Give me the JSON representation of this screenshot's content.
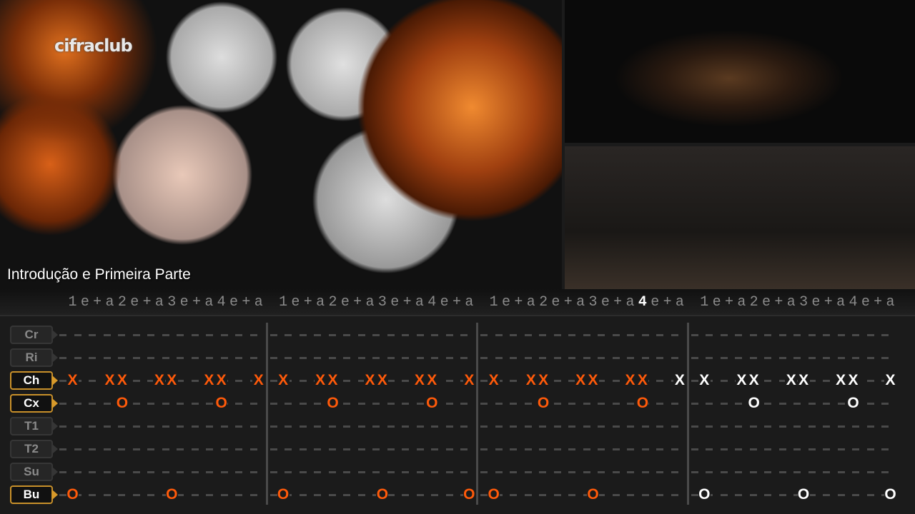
{
  "video": {
    "caption": "Introdução e Primeira Parte",
    "logo": "cifraclub"
  },
  "count": [
    "1",
    "e",
    "+",
    "a",
    "2",
    "e",
    "+",
    "a",
    "3",
    "e",
    "+",
    "a",
    "4",
    "e",
    "+",
    "a"
  ],
  "playhead": {
    "measure": 3,
    "position": 13
  },
  "colors": {
    "played": "#ff5a0a",
    "upcoming": "#ffffff",
    "accent": "#c8902a"
  },
  "rows": [
    {
      "label": "Cr",
      "active": false,
      "measures": [
        "................",
        "................",
        "................",
        "................"
      ]
    },
    {
      "label": "Ri",
      "active": false,
      "measures": [
        "................",
        "................",
        "................",
        "................"
      ]
    },
    {
      "label": "Ch",
      "active": true,
      "measures": [
        "X..XX..XX..XX..X",
        "X..XX..XX..XX..X",
        "X..XX..XX..XX..X",
        "X..XX..XX..XX..X"
      ]
    },
    {
      "label": "Cx",
      "active": true,
      "measures": [
        "....O.......O...",
        "....O.......O...",
        "....O.......O...",
        "....O.......O..."
      ]
    },
    {
      "label": "T1",
      "active": false,
      "measures": [
        "................",
        "................",
        "................",
        "................"
      ]
    },
    {
      "label": "T2",
      "active": false,
      "measures": [
        "................",
        "................",
        "................",
        "................"
      ]
    },
    {
      "label": "Su",
      "active": false,
      "measures": [
        "................",
        "................",
        "................",
        "................"
      ]
    },
    {
      "label": "Bu",
      "active": true,
      "measures": [
        "O.......O.......",
        "O.......O......O",
        "O.......O.......",
        "O.......O......O"
      ]
    }
  ]
}
